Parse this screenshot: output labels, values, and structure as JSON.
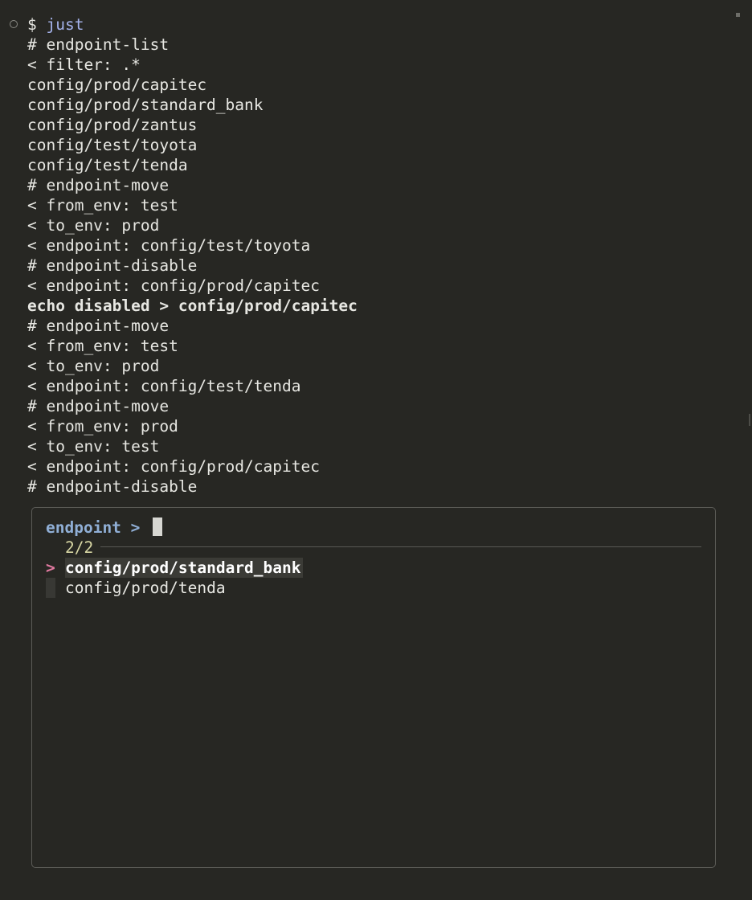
{
  "terminal": {
    "prompt_symbol": "$",
    "command": "just",
    "lines": [
      "# endpoint-list",
      "< filter: .*",
      "config/prod/capitec",
      "config/prod/standard_bank",
      "config/prod/zantus",
      "config/test/toyota",
      "config/test/tenda",
      "# endpoint-move",
      "< from_env: test",
      "< to_env: prod",
      "< endpoint: config/test/toyota",
      "# endpoint-disable",
      "< endpoint: config/prod/capitec",
      "echo disabled > config/prod/capitec",
      "# endpoint-move",
      "< from_env: test",
      "< to_env: prod",
      "< endpoint: config/test/tenda",
      "# endpoint-move",
      "< from_env: prod",
      "< to_env: test",
      "< endpoint: config/prod/capitec",
      "# endpoint-disable"
    ]
  },
  "finder": {
    "query_label": "endpoint >",
    "query_value": "",
    "match_count": "2/2",
    "pointer": ">",
    "items": [
      "config/prod/standard_bank",
      "config/prod/tenda"
    ],
    "selected_index": 0
  },
  "colors": {
    "background": "#272723",
    "text": "#e7e7e2",
    "command": "#a4b2ea",
    "query_label": "#90afd6",
    "counter": "#d8d7a4",
    "pointer": "#e27aa1"
  }
}
